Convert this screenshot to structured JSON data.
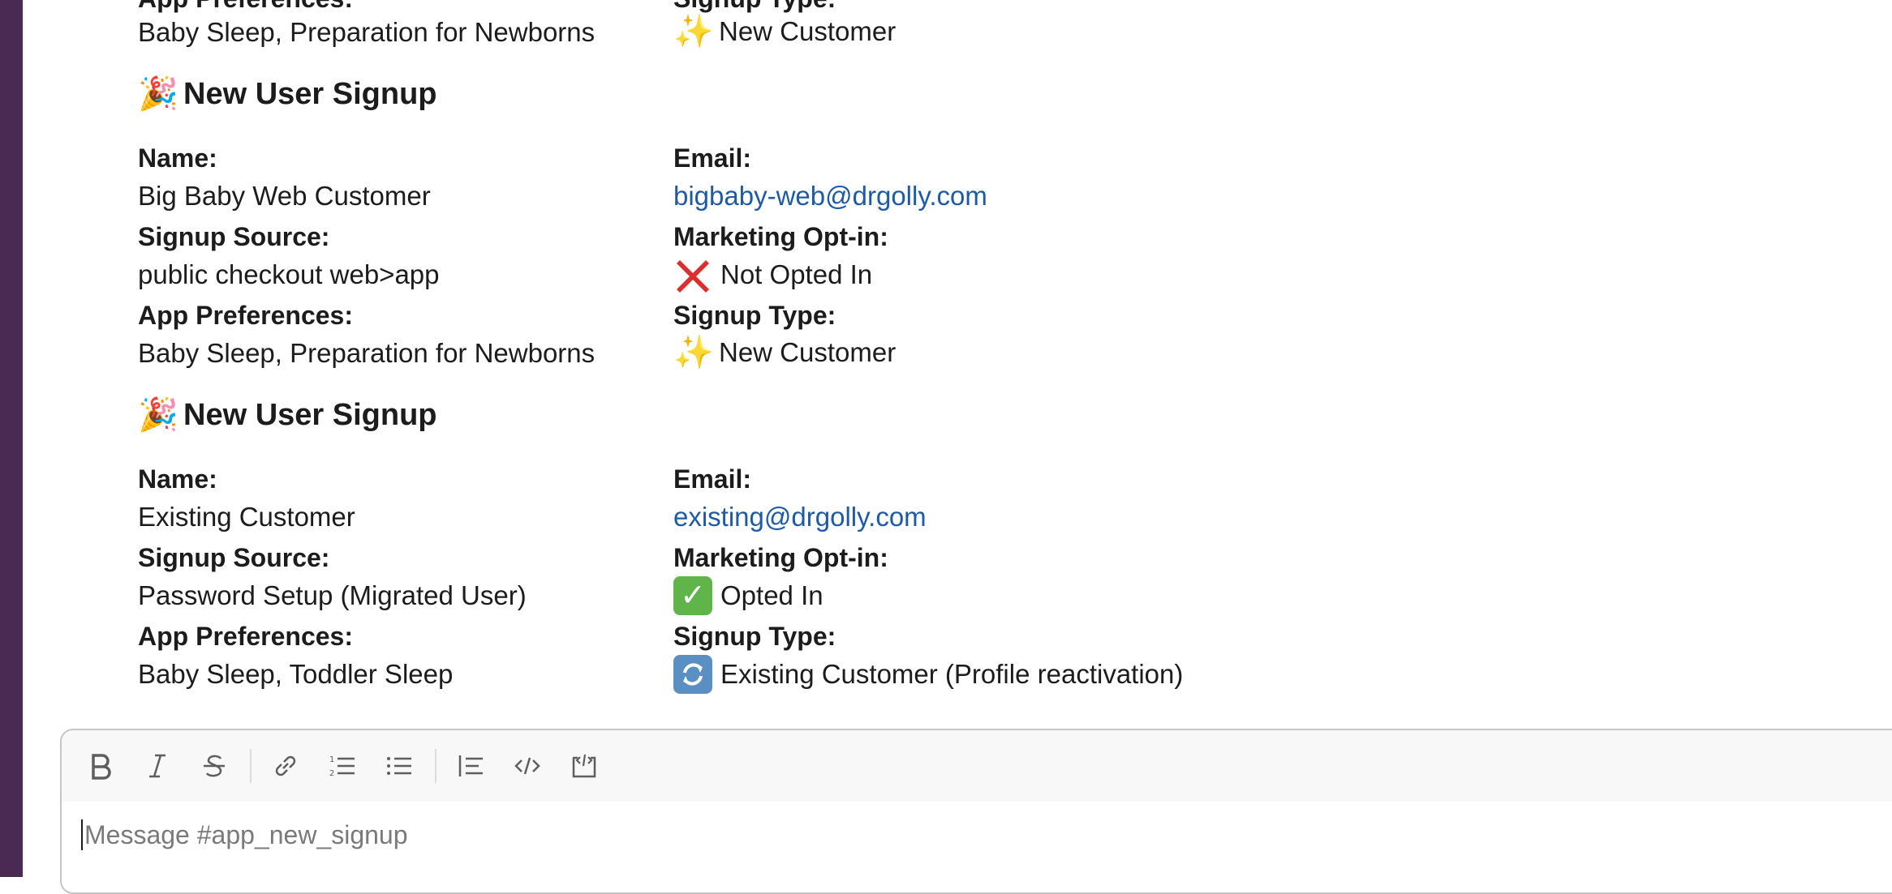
{
  "channel": "app_new_signup",
  "colors": {
    "sidebar": "#4a2a52",
    "link": "#1d5ba6"
  },
  "top_partial": {
    "left_label": "App Preferences:",
    "left_value": "Baby Sleep, Preparation for Newborns",
    "right_label": "Signup Type:",
    "right_emoji": "✨",
    "right_value": "New Customer"
  },
  "messages": [
    {
      "heading_emoji": "🎉",
      "heading": "New User Signup",
      "name_label": "Name:",
      "name": "Big Baby Web Customer",
      "email_label": "Email:",
      "email": "bigbaby-web@drgolly.com",
      "source_label": "Signup Source:",
      "source": "public checkout web>app",
      "optin_label": "Marketing Opt-in:",
      "optin_emoji": "❌",
      "optin": "Not Opted In",
      "prefs_label": "App Preferences:",
      "prefs": "Baby Sleep, Preparation for Newborns",
      "type_label": "Signup Type:",
      "type_emoji": "✨",
      "type": "New Customer"
    },
    {
      "heading_emoji": "🎉",
      "heading": "New User Signup",
      "name_label": "Name:",
      "name": "Existing Customer",
      "email_label": "Email:",
      "email": "existing@drgolly.com",
      "source_label": "Signup Source:",
      "source": "Password Setup (Migrated User)",
      "optin_label": "Marketing Opt-in:",
      "optin_emoji": "✅",
      "optin": "Opted In",
      "prefs_label": "App Preferences:",
      "prefs": "Baby Sleep, Toddler Sleep",
      "type_label": "Signup Type:",
      "type_emoji": "🔄",
      "type": "Existing Customer (Profile reactivation)"
    }
  ],
  "composer": {
    "placeholder": "Message #app_new_signup",
    "toolbar": [
      "bold-icon",
      "italic-icon",
      "strikethrough-icon",
      "link-icon",
      "numbered-list-icon",
      "bulleted-list-icon",
      "blockquote-icon",
      "code-icon",
      "code-block-icon"
    ]
  }
}
